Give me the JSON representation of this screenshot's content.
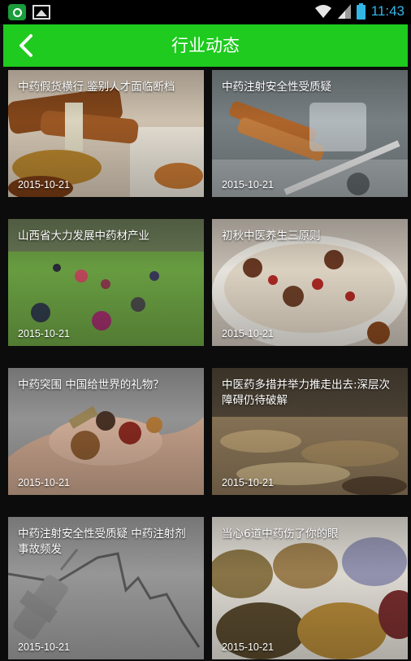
{
  "status_bar": {
    "time": "11:43"
  },
  "header": {
    "title": "行业动态",
    "accent": "#1ecb1e"
  },
  "articles": [
    {
      "title": "中药假货横行 鉴别人才面临断档",
      "date": "2015-10-21"
    },
    {
      "title": "中药注射安全性受质疑",
      "date": "2015-10-21"
    },
    {
      "title": "山西省大力发展中药材产业",
      "date": "2015-10-21"
    },
    {
      "title": "初秋中医养生三原则",
      "date": "2015-10-21"
    },
    {
      "title": "中药突围 中国给世界的礼物？",
      "date": "2015-10-21"
    },
    {
      "title": "中医药多措并举力推走出去:深层次障碍仍待破解",
      "date": "2015-10-21"
    },
    {
      "title": "中药注射安全性受质疑 中药注射剂事故频发",
      "date": "2015-10-21"
    },
    {
      "title": "当心6道中药伤了你的眼",
      "date": "2015-10-21"
    }
  ],
  "icons": {
    "app_notification": "app-notification-icon",
    "image_notification": "image-notification-icon",
    "wifi": "wifi-icon",
    "signal": "signal-icon",
    "battery": "battery-icon",
    "back": "back-arrow-icon"
  }
}
